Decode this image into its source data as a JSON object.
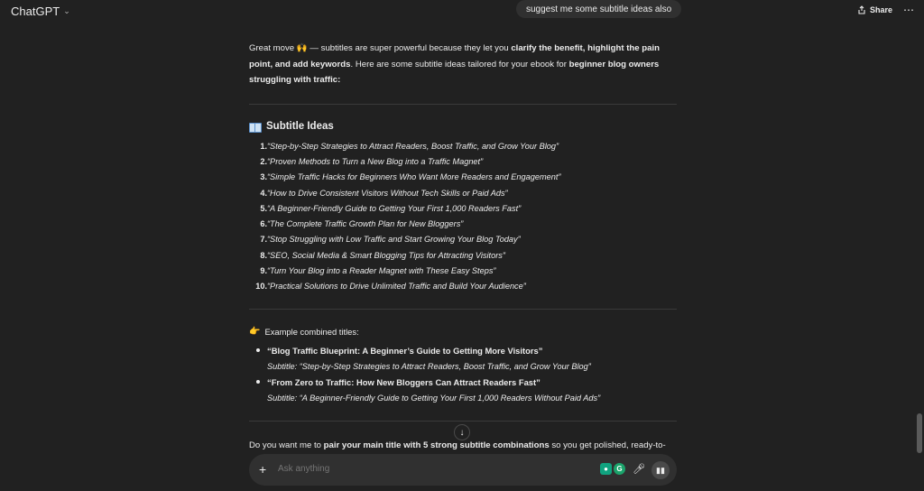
{
  "app": {
    "title": "ChatGPT"
  },
  "header": {
    "user_message": "suggest me some subtitle ideas also",
    "share_label": "Share",
    "more_label": "⋯"
  },
  "intro": {
    "p1": "Great move 🙌 — subtitles are super powerful because they let you ",
    "b1": "clarify the benefit, highlight the pain point, and add keywords",
    "p2": ". Here are some subtitle ideas tailored for your ebook for ",
    "b2": "beginner blog owners struggling with traffic:"
  },
  "section": {
    "title": "Subtitle Ideas",
    "icon": "book-icon"
  },
  "subtitles": [
    {
      "num": "1.",
      "text": "“Step-by-Step Strategies to Attract Readers, Boost Traffic, and Grow Your Blog”"
    },
    {
      "num": "2.",
      "text": "“Proven Methods to Turn a New Blog into a Traffic Magnet”"
    },
    {
      "num": "3.",
      "text": "“Simple Traffic Hacks for Beginners Who Want More Readers and Engagement”"
    },
    {
      "num": "4.",
      "text": "“How to Drive Consistent Visitors Without Tech Skills or Paid Ads”"
    },
    {
      "num": "5.",
      "text": "“A Beginner-Friendly Guide to Getting Your First 1,000 Readers Fast”"
    },
    {
      "num": "6.",
      "text": "“The Complete Traffic Growth Plan for New Bloggers”"
    },
    {
      "num": "7.",
      "text": "“Stop Struggling with Low Traffic and Start Growing Your Blog Today”"
    },
    {
      "num": "8.",
      "text": "“SEO, Social Media & Smart Blogging Tips for Attracting Visitors”"
    },
    {
      "num": "9.",
      "text": "“Turn Your Blog into a Reader Magnet with These Easy Steps”"
    },
    {
      "num": "10.",
      "text": "“Practical Solutions to Drive Unlimited Traffic and Build Your Audience”"
    }
  ],
  "example": {
    "heading": "Example combined titles:",
    "items": [
      {
        "title": "“Blog Traffic Blueprint: A Beginner’s Guide to Getting More Visitors”",
        "subtitle": "Subtitle: “Step-by-Step Strategies to Attract Readers, Boost Traffic, and Grow Your Blog”"
      },
      {
        "title": "“From Zero to Traffic: How New Bloggers Can Attract Readers Fast”",
        "subtitle": "Subtitle: “A Beginner-Friendly Guide to Getting Your First 1,000 Readers Without Paid Ads”"
      }
    ]
  },
  "followup": {
    "p1": "Do you want me to ",
    "b1": "pair your main title with 5 strong subtitle combinations",
    "p2": " so you get polished, ready-to-"
  },
  "composer": {
    "placeholder": "Ask anything"
  }
}
